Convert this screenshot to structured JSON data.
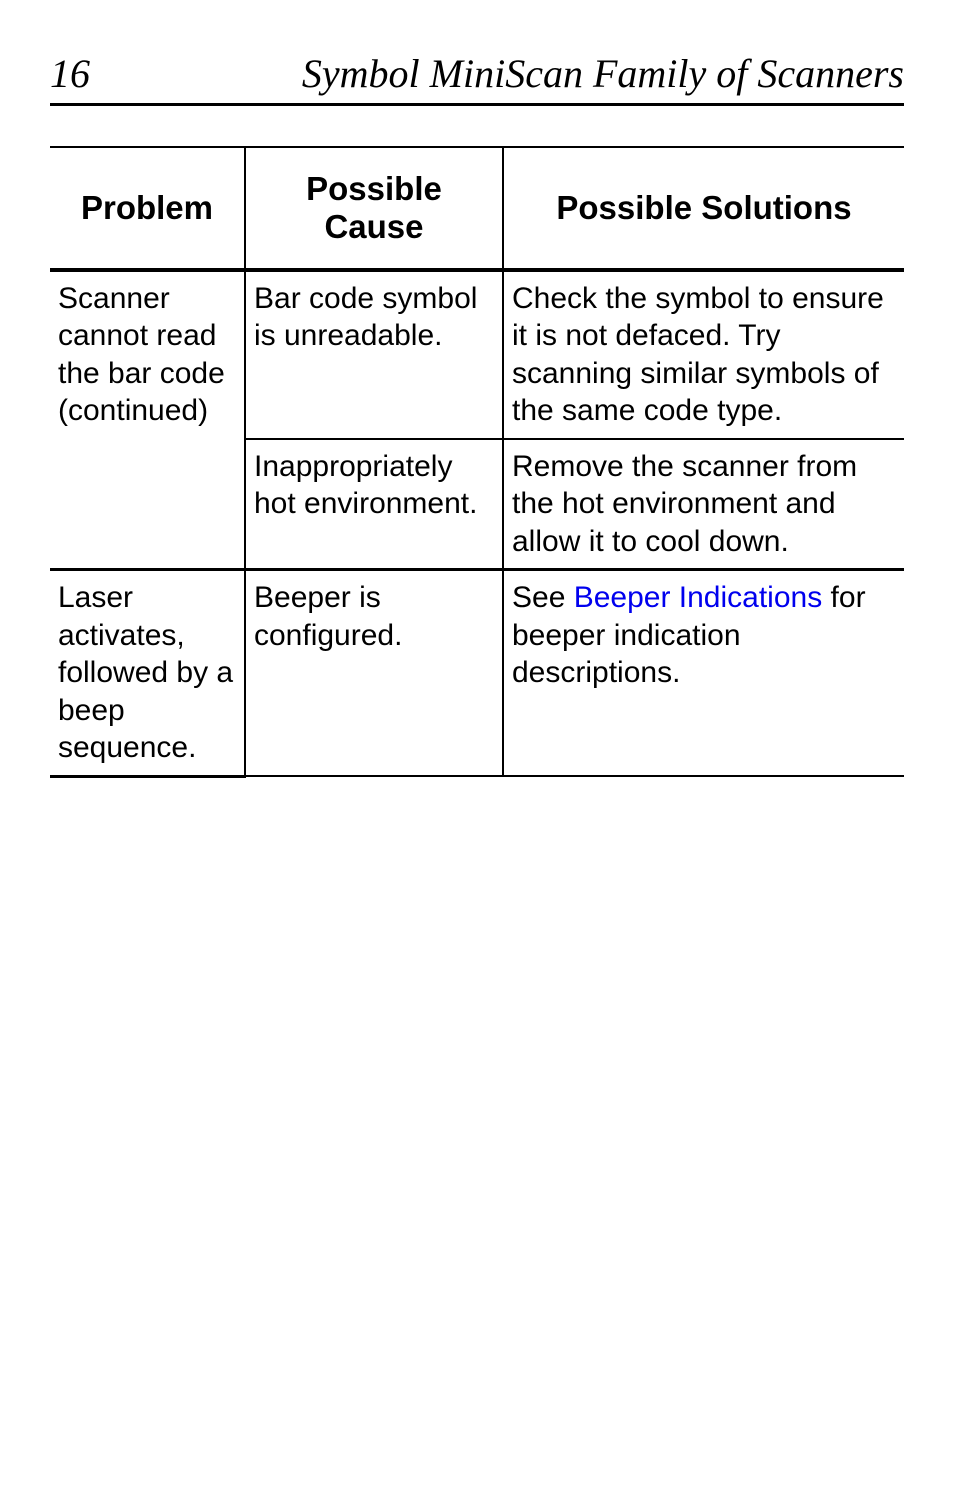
{
  "header": {
    "page_number": "16",
    "title": "Symbol MiniScan Family of Scanners"
  },
  "table": {
    "columns": {
      "problem": "Problem",
      "cause": "Possible Cause",
      "solutions": "Possible Solutions"
    },
    "rows": {
      "r1": {
        "problem": "Scanner cannot read the bar code (continued)",
        "cause": "Bar code symbol is unreadable.",
        "solution": "Check the symbol to ensure it is not defaced. Try scanning similar symbols of the same code type."
      },
      "r2": {
        "cause": "Inappropriately hot environment.",
        "solution": "Remove the scanner from the hot environment and allow it to cool down."
      },
      "r3": {
        "problem": "Laser activates, followed by a beep sequence.",
        "cause": "Beeper is configured.",
        "solution_pre": "See ",
        "solution_link": "Beeper Indications",
        "solution_post": " for beeper indication descriptions."
      }
    }
  }
}
